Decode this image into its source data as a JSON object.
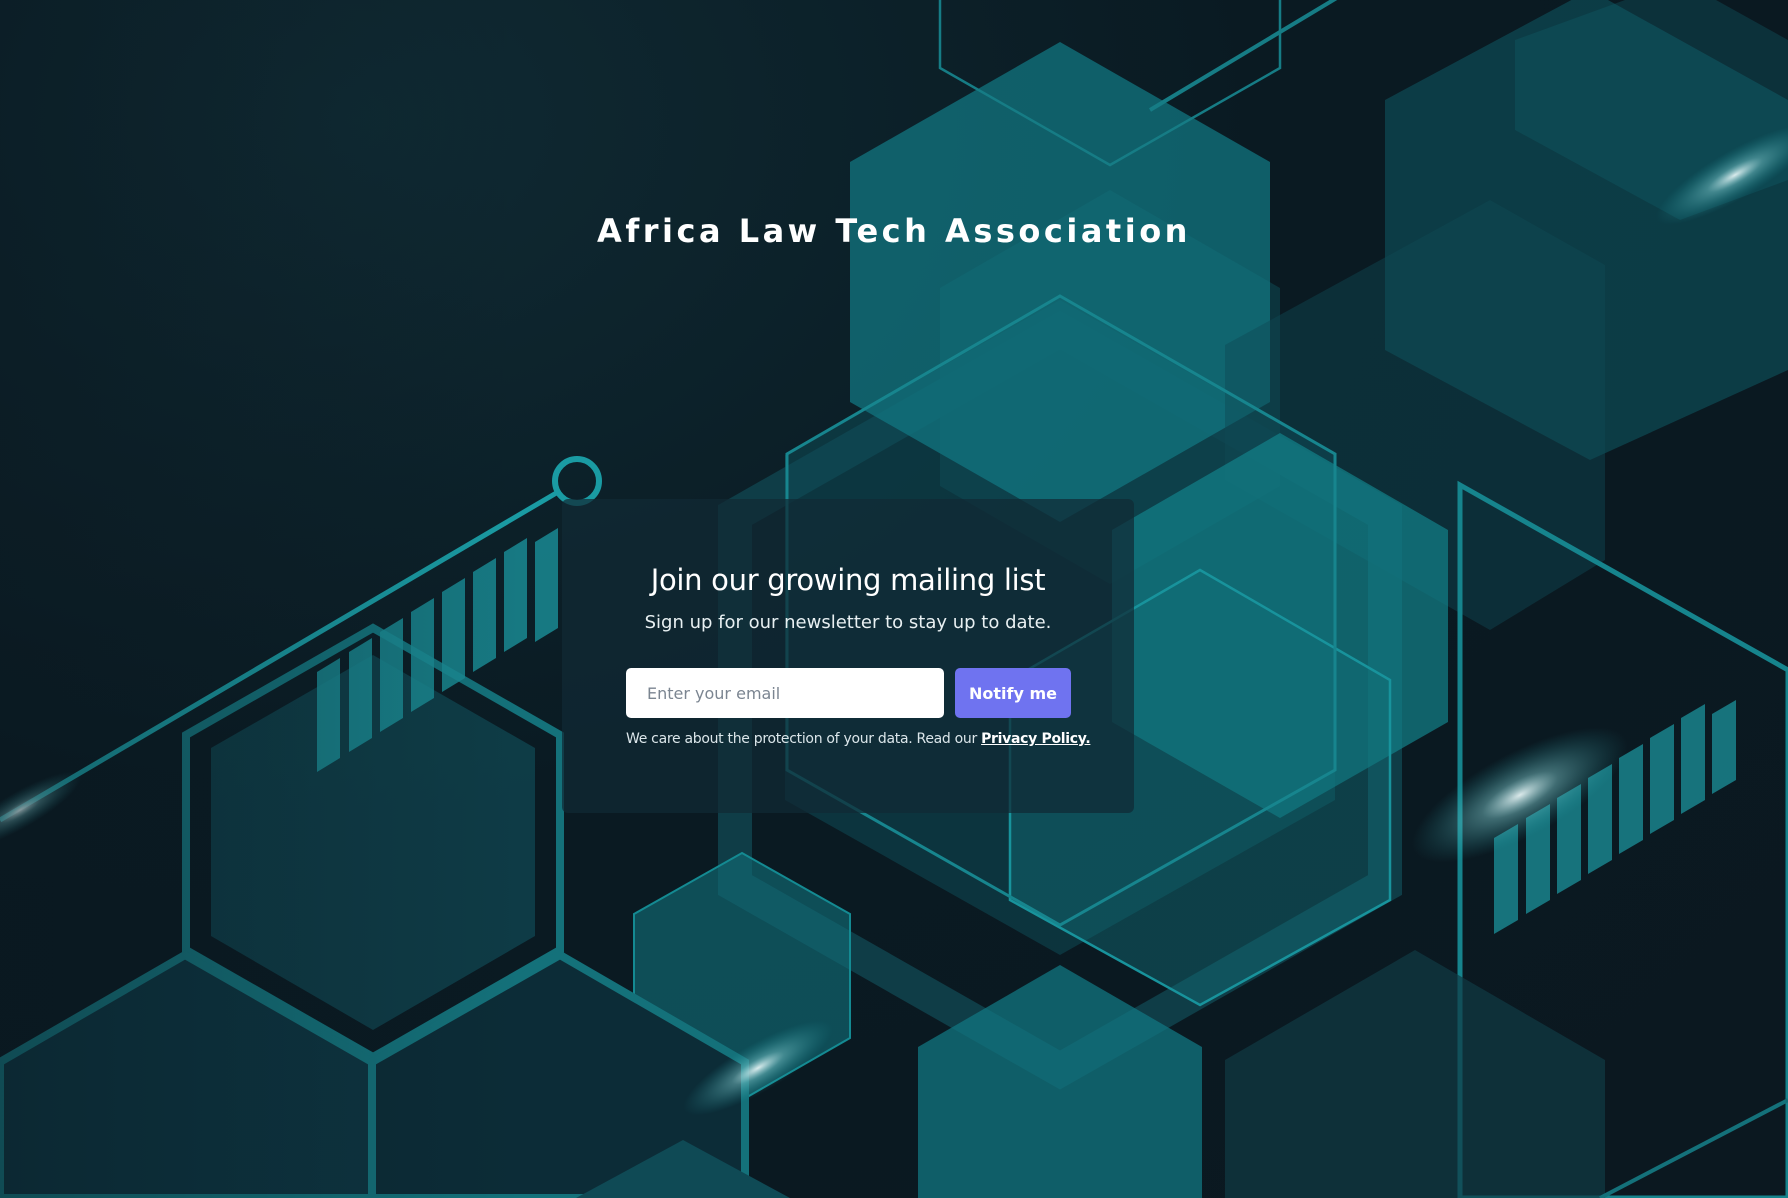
{
  "site": {
    "title": "Africa Law Tech Association"
  },
  "signup": {
    "heading": "Join our growing mailing list",
    "subheading": "Sign up for our newsletter to stay up to date.",
    "email_placeholder": "Enter your email",
    "email_value": "",
    "button_label": "Notify me",
    "privacy_text": "We care about the protection of your data. Read our ",
    "privacy_link_label": "Privacy Policy."
  },
  "colors": {
    "background": "#0b1820",
    "accent_teal": "#1a9ba3",
    "button": "#6f73f0",
    "card": "#102a34"
  },
  "background_art": {
    "icon": "hexagon-network-illustration"
  }
}
